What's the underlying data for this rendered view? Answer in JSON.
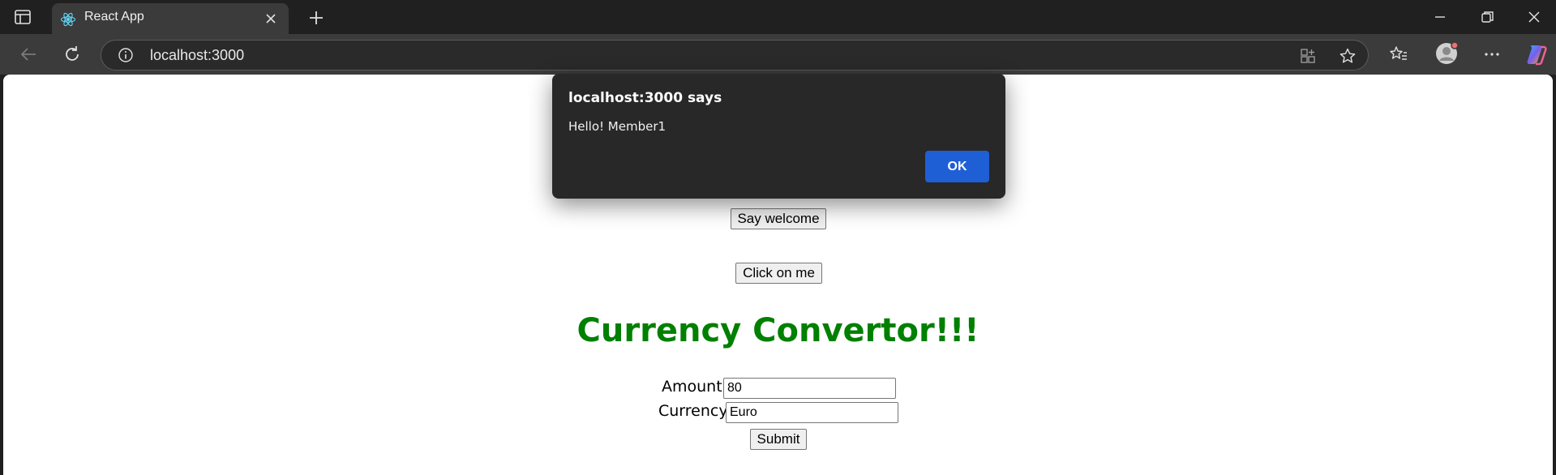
{
  "browser": {
    "tab_title": "React App",
    "url": "localhost:3000",
    "icons": {
      "tab_actions": "tab-actions-icon",
      "favicon": "react-logo-icon",
      "tab_close": "close-icon",
      "new_tab": "plus-icon",
      "minimize": "minimize-icon",
      "restore": "restore-icon",
      "close_window": "close-icon",
      "back": "back-arrow-icon",
      "refresh": "refresh-icon",
      "site_info": "info-icon",
      "app_available": "app-icon",
      "favorite": "star-icon",
      "favorites": "favorites-icon",
      "profile": "profile-icon",
      "more": "more-icon",
      "copilot": "copilot-icon"
    }
  },
  "page": {
    "say_welcome_label": "Say welcome",
    "click_me_label": "Click on me",
    "heading": "Currency Convertor!!!",
    "amount_label": "Amount:",
    "amount_value": "80",
    "currency_label": "Currency:",
    "currency_value": "Euro",
    "submit_label": "Submit",
    "heading_color": "#008000"
  },
  "dialog": {
    "title": "localhost:3000 says",
    "message": "Hello! Member1",
    "ok_label": "OK",
    "ok_color": "#1f5fd6"
  }
}
